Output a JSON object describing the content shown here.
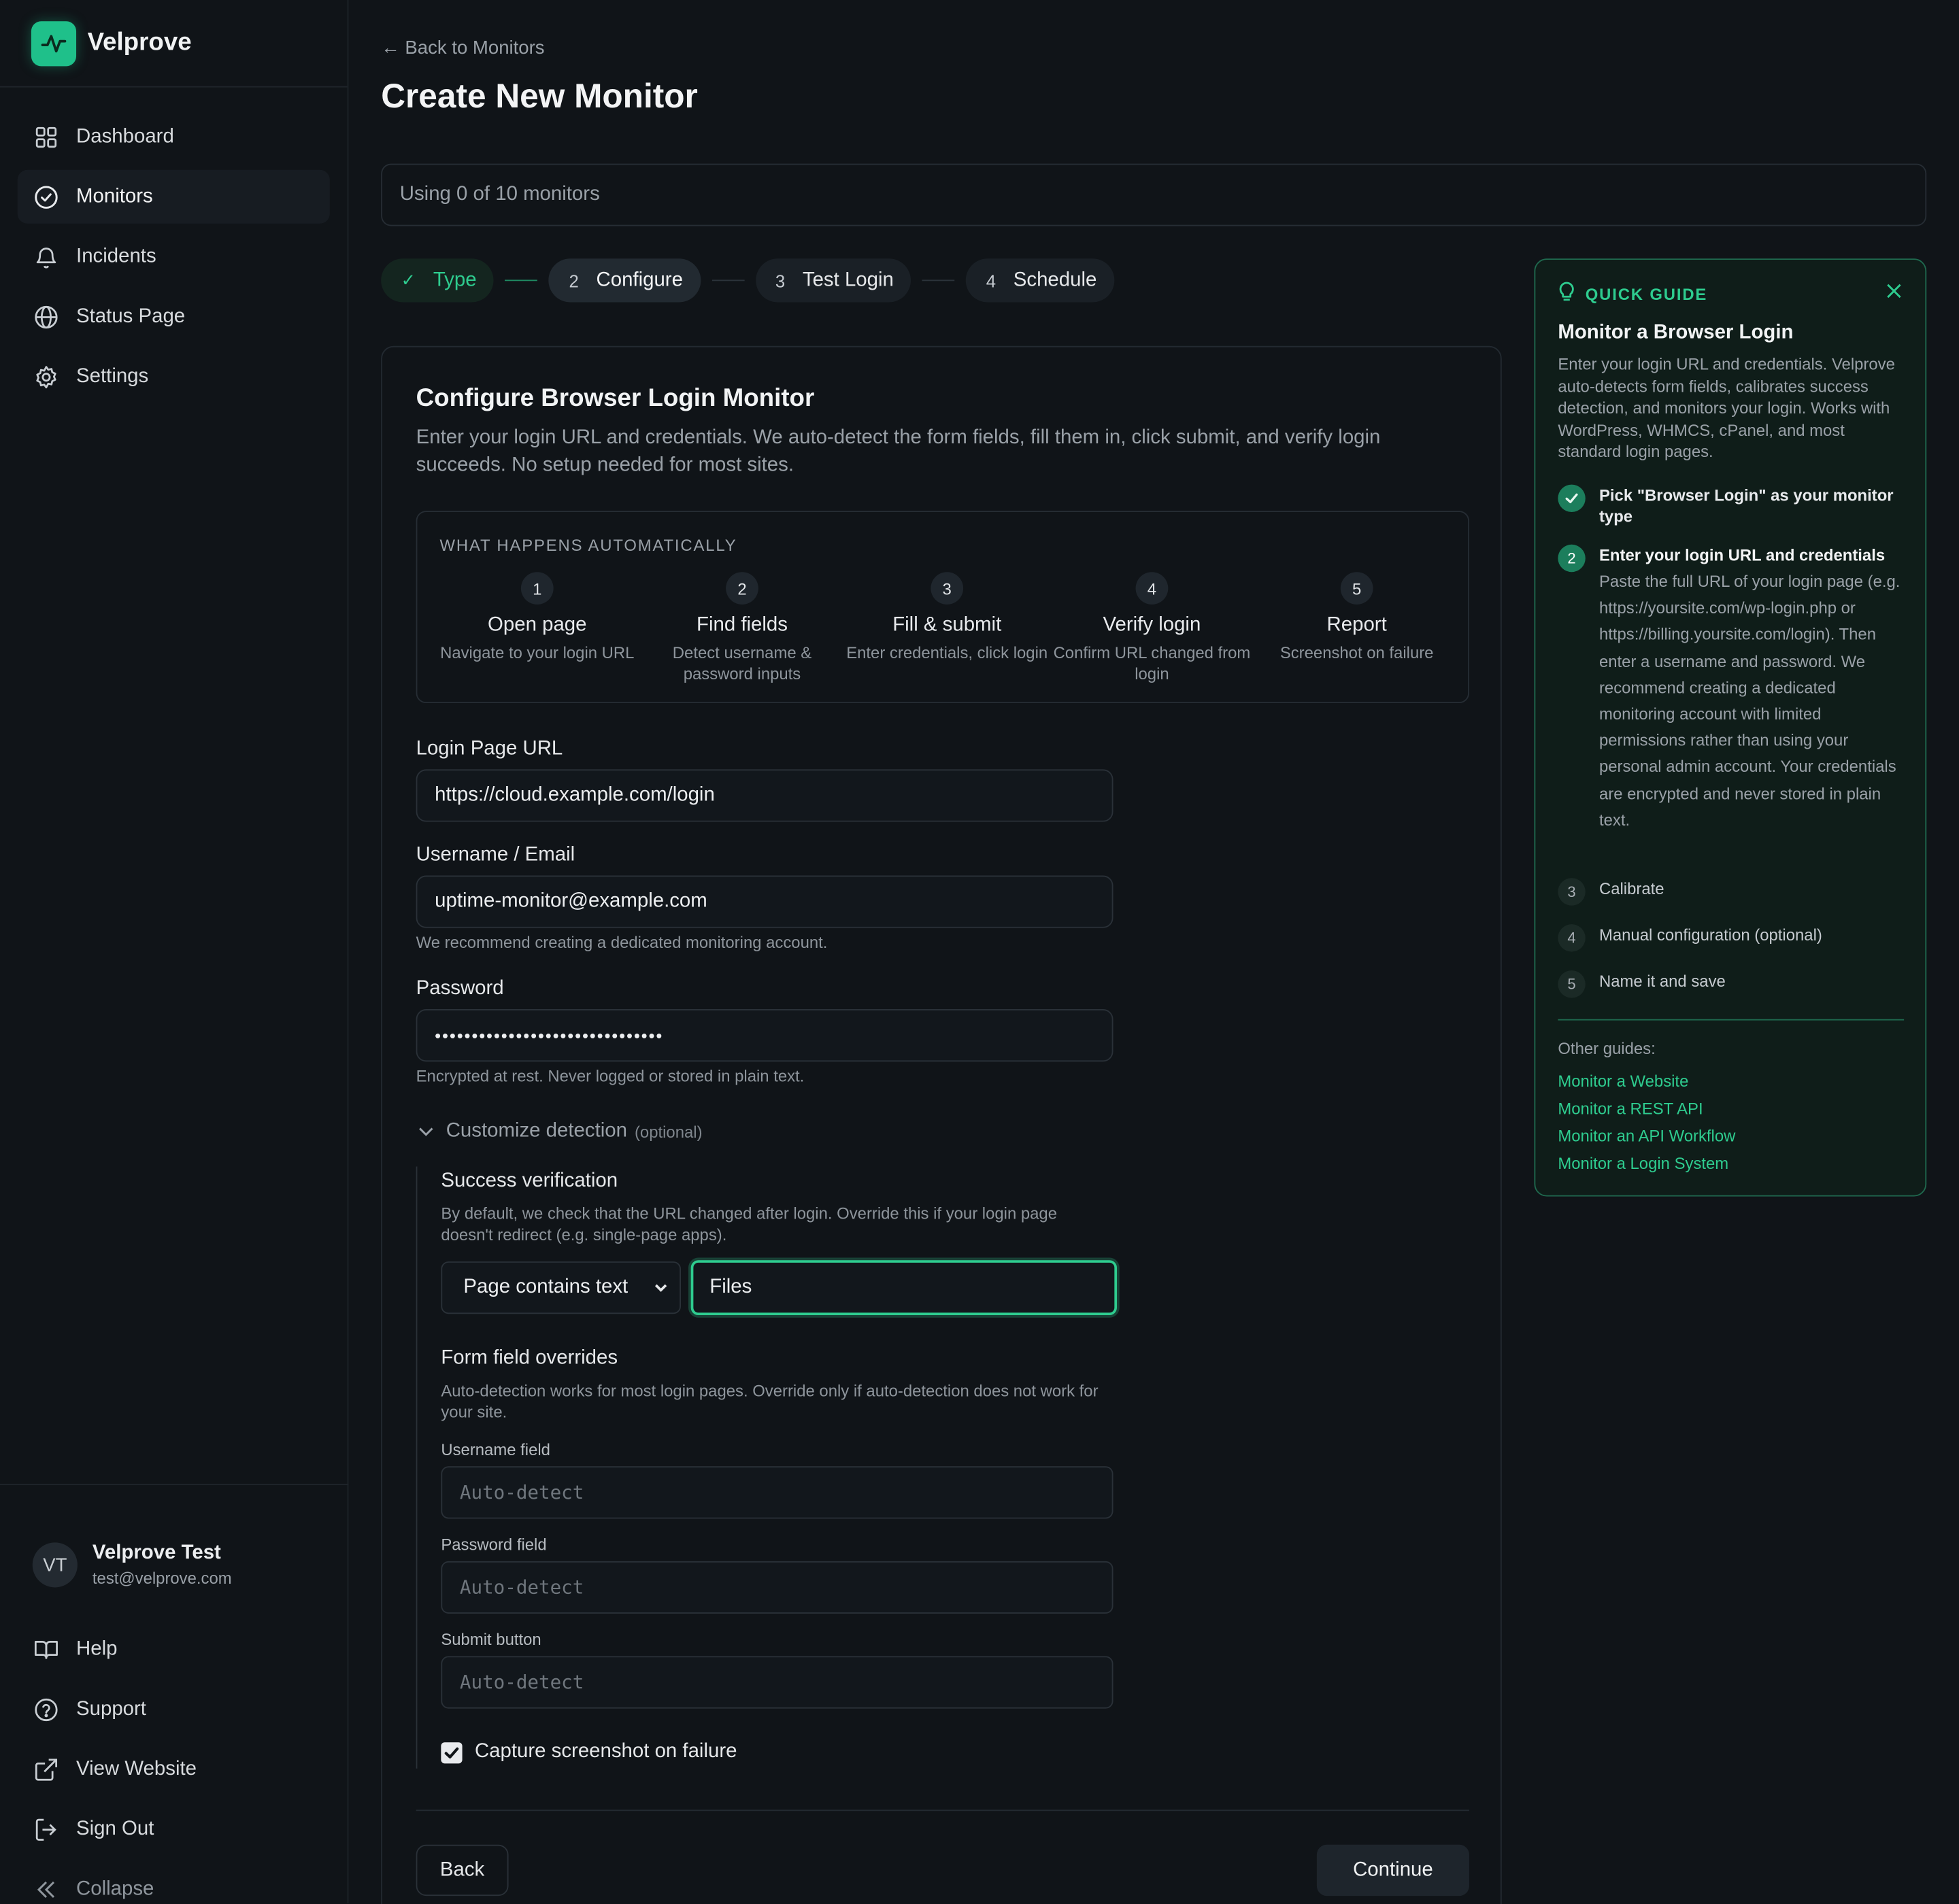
{
  "brand": {
    "name": "Velprove"
  },
  "nav": [
    {
      "label": "Dashboard",
      "icon": "grid-icon"
    },
    {
      "label": "Monitors",
      "icon": "check-circle-icon",
      "active": true
    },
    {
      "label": "Incidents",
      "icon": "bell-icon"
    },
    {
      "label": "Status Page",
      "icon": "globe-icon"
    },
    {
      "label": "Settings",
      "icon": "gear-icon"
    }
  ],
  "user": {
    "initials": "VT",
    "name": "Velprove Test",
    "email": "test@velprove.com"
  },
  "side_links": [
    {
      "label": "Help",
      "icon": "book-icon"
    },
    {
      "label": "Support",
      "icon": "question-circle-icon"
    },
    {
      "label": "View Website",
      "icon": "external-link-icon"
    },
    {
      "label": "Sign Out",
      "icon": "sign-out-icon"
    },
    {
      "label": "Collapse",
      "icon": "double-chevron-left-icon"
    }
  ],
  "header": {
    "back": "← Back to Monitors",
    "title": "Create New Monitor"
  },
  "usage": "Using 0 of 10 monitors",
  "steps": [
    {
      "num": "✓",
      "label": "Type",
      "state": "done"
    },
    {
      "num": "2",
      "label": "Configure",
      "state": "active"
    },
    {
      "num": "3",
      "label": "Test Login",
      "state": "pending"
    },
    {
      "num": "4",
      "label": "Schedule",
      "state": "pending"
    }
  ],
  "form": {
    "title": "Configure Browser Login Monitor",
    "description": "Enter your login URL and credentials. We auto-detect the form fields, fill them in, click submit, and verify login succeeds. No setup needed for most sites.",
    "auto_heading": "WHAT HAPPENS AUTOMATICALLY",
    "auto_steps": [
      {
        "num": "1",
        "title": "Open page",
        "sub": "Navigate to your login URL"
      },
      {
        "num": "2",
        "title": "Find fields",
        "sub": "Detect username & password inputs"
      },
      {
        "num": "3",
        "title": "Fill & submit",
        "sub": "Enter credentials, click login"
      },
      {
        "num": "4",
        "title": "Verify login",
        "sub": "Confirm URL changed from login"
      },
      {
        "num": "5",
        "title": "Report",
        "sub": "Screenshot on failure"
      }
    ],
    "url_label": "Login Page URL",
    "url_value": "https://cloud.example.com/login",
    "username_label": "Username / Email",
    "username_value": "uptime-monitor@example.com",
    "username_hint": "We recommend creating a dedicated monitoring account.",
    "password_label": "Password",
    "password_value": "•••••••••••••••••••••••••••••••",
    "password_hint": "Encrypted at rest. Never logged or stored in plain text.",
    "customize_label": "Customize detection",
    "customize_optional": "(optional)",
    "success_title": "Success verification",
    "success_desc": "By default, we check that the URL changed after login. Override this if your login page doesn't redirect (e.g. single-page apps).",
    "success_select": "Page contains text",
    "success_text": "Files",
    "overrides_title": "Form field overrides",
    "overrides_desc": "Auto-detection works for most login pages. Override only if auto-detection does not work for your site.",
    "username_field_label": "Username field",
    "password_field_label": "Password field",
    "submit_button_label": "Submit button",
    "auto_placeholder": "Auto-detect",
    "capture_label": "Capture screenshot on failure",
    "capture_checked": true,
    "back_button": "Back",
    "continue_button": "Continue"
  },
  "guide": {
    "heading": "QUICK GUIDE",
    "title": "Monitor a Browser Login",
    "description": "Enter your login URL and credentials. Velprove auto-detects form fields, calibrates success detection, and monitors your login. Works with WordPress, WHMCS, cPanel, and most standard login pages.",
    "steps": [
      {
        "num": "✓",
        "label": "Pick \"Browser Login\" as your monitor type",
        "state": "done"
      },
      {
        "num": "2",
        "label": "Enter your login URL and credentials",
        "state": "active"
      },
      {
        "num": "3",
        "label": "Calibrate",
        "state": "pending"
      },
      {
        "num": "4",
        "label": "Manual configuration (optional)",
        "state": "pending"
      },
      {
        "num": "5",
        "label": "Name it and save",
        "state": "pending"
      }
    ],
    "active_detail": "Paste the full URL of your login page (e.g. https://yoursite.com/wp-login.php or https://billing.yoursite.com/login). Then enter a username and password. We recommend creating a dedicated monitoring account with limited permissions rather than using your personal admin account. Your credentials are encrypted and never stored in plain text.",
    "other_label": "Other guides:",
    "links": [
      "Monitor a Website",
      "Monitor a REST API",
      "Monitor an API Workflow",
      "Monitor a Login System"
    ]
  },
  "colors": {
    "accent": "#2ecc8f",
    "background": "#101418"
  }
}
